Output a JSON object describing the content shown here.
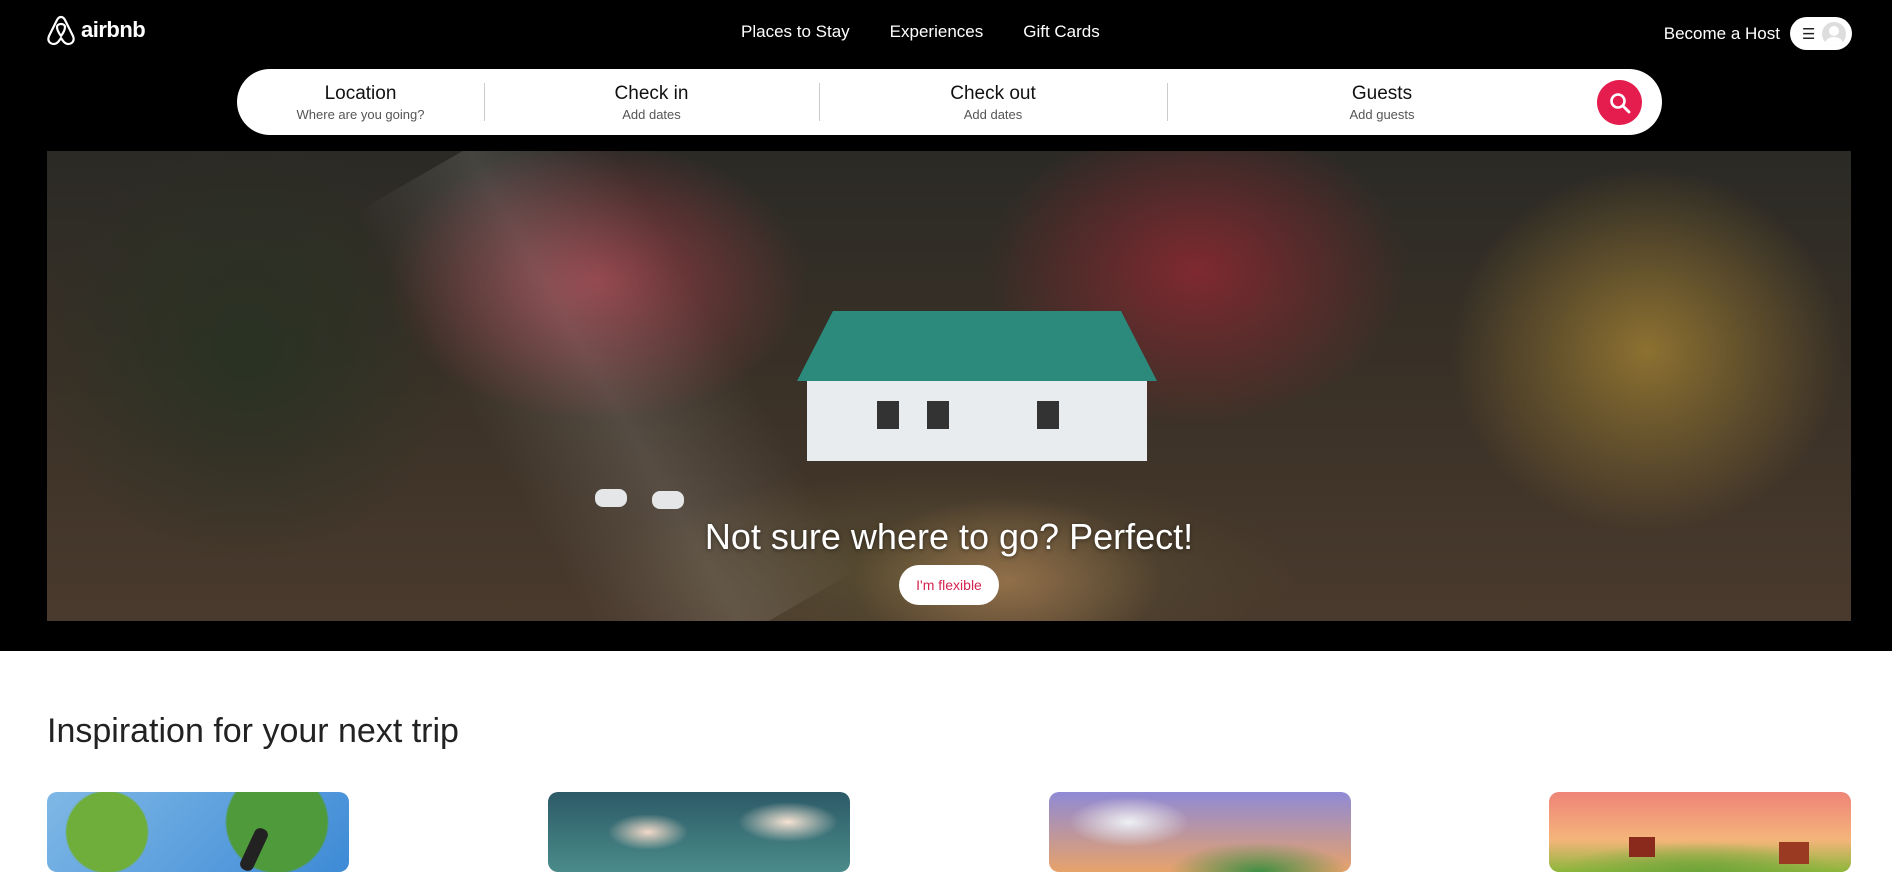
{
  "brand": {
    "name": "airbnb",
    "accent": "#e51d4f"
  },
  "nav": {
    "items": [
      "Places to Stay",
      "Experiences",
      "Gift Cards"
    ]
  },
  "header": {
    "host_label": "Become a Host",
    "menu_icon": "hamburger-icon",
    "avatar_icon": "user-avatar-icon"
  },
  "search": {
    "location": {
      "label": "Location",
      "sub": "Where are you going?"
    },
    "checkin": {
      "label": "Check in",
      "sub": "Add dates"
    },
    "checkout": {
      "label": "Check out",
      "sub": "Add dates"
    },
    "guests": {
      "label": "Guests",
      "sub": "Add guests"
    },
    "button_icon": "search-icon"
  },
  "hero": {
    "title": "Not sure where to go? Perfect!",
    "button_label": "I'm flexible"
  },
  "inspiration": {
    "title": "Inspiration for your next trip"
  }
}
